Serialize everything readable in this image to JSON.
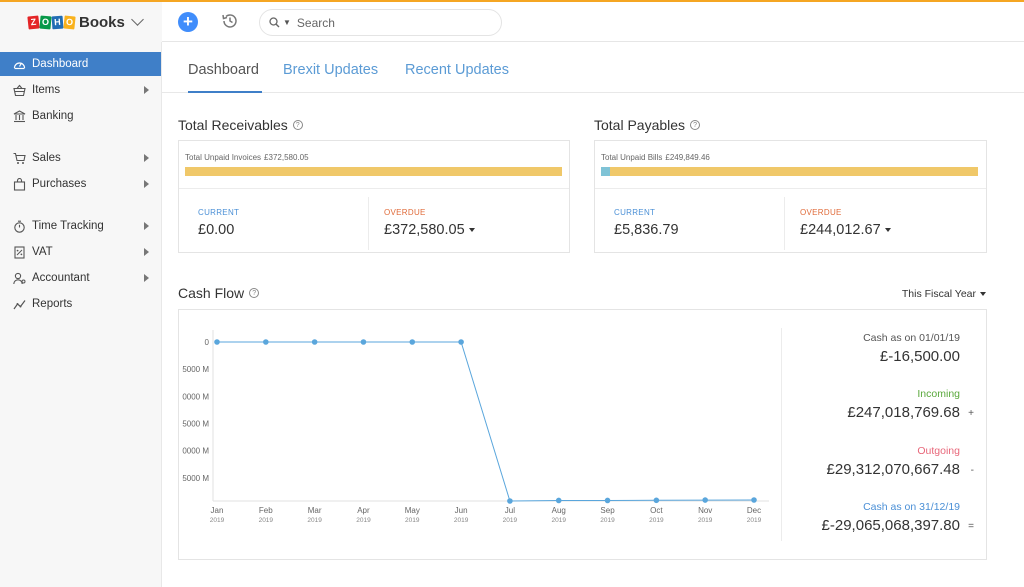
{
  "header": {
    "brand": "Books",
    "logo_letters": [
      "Z",
      "O",
      "H",
      "O"
    ],
    "search_placeholder": "Search"
  },
  "sidebar": {
    "items": [
      {
        "label": "Dashboard",
        "icon": "dashboard-icon",
        "active": true,
        "has_arrow": false
      },
      {
        "label": "Items",
        "icon": "basket-icon",
        "active": false,
        "has_arrow": true
      },
      {
        "label": "Banking",
        "icon": "bank-icon",
        "active": false,
        "has_arrow": false
      },
      {
        "label": "Sales",
        "icon": "cart-icon",
        "active": false,
        "has_arrow": true
      },
      {
        "label": "Purchases",
        "icon": "bag-icon",
        "active": false,
        "has_arrow": true
      },
      {
        "label": "Time Tracking",
        "icon": "stopwatch-icon",
        "active": false,
        "has_arrow": true
      },
      {
        "label": "VAT",
        "icon": "vat-doc-icon",
        "active": false,
        "has_arrow": true
      },
      {
        "label": "Accountant",
        "icon": "accountant-icon",
        "active": false,
        "has_arrow": true
      },
      {
        "label": "Reports",
        "icon": "reports-icon",
        "active": false,
        "has_arrow": false
      }
    ]
  },
  "tabs": [
    {
      "label": "Dashboard",
      "active": true
    },
    {
      "label": "Brexit Updates",
      "active": false
    },
    {
      "label": "Recent Updates",
      "active": false
    }
  ],
  "receivables": {
    "title": "Total Receivables",
    "bar_label": "Total Unpaid Invoices",
    "bar_amount": "£372,580.05",
    "current_fraction": 0,
    "current_label": "CURRENT",
    "current_value": "£0.00",
    "overdue_label": "OVERDUE",
    "overdue_value": "£372,580.05"
  },
  "payables": {
    "title": "Total Payables",
    "bar_label": "Total Unpaid Bills",
    "bar_amount": "£249,849.46",
    "current_fraction": 0.023,
    "current_label": "CURRENT",
    "current_value": "£5,836.79",
    "overdue_label": "OVERDUE",
    "overdue_value": "£244,012.67"
  },
  "cashflow": {
    "title": "Cash Flow",
    "period": "This Fiscal Year",
    "summary": {
      "opening_label": "Cash as on 01/01/19",
      "opening_value": "£-16,500.00",
      "incoming_label": "Incoming",
      "incoming_value": "£247,018,769.68",
      "incoming_sign": "+",
      "outgoing_label": "Outgoing",
      "outgoing_value": "£29,312,070,667.48",
      "outgoing_sign": "-",
      "closing_label": "Cash as on 31/12/19",
      "closing_value": "£-29,065,068,397.80",
      "closing_sign": "="
    }
  },
  "colors": {
    "accent": "#3f7fc8",
    "link_blue": "#5b9bd5",
    "bar_overdue": "#f0c869",
    "bar_current": "#7fc3d6",
    "incoming": "#5aa83c",
    "outgoing": "#e8677a",
    "closing": "#4a8fd6",
    "series": "#5aa6dc"
  },
  "chart_data": {
    "type": "line",
    "categories": [
      "Jan 2019",
      "Feb 2019",
      "Mar 2019",
      "Apr 2019",
      "May 2019",
      "Jun 2019",
      "Jul 2019",
      "Aug 2019",
      "Sep 2019",
      "Oct 2019",
      "Nov 2019",
      "Dec 2019"
    ],
    "x_month_labels": [
      "Jan",
      "Feb",
      "Mar",
      "Apr",
      "May",
      "Jun",
      "Jul",
      "Aug",
      "Sep",
      "Oct",
      "Nov",
      "Dec"
    ],
    "x_year_labels": [
      "2019",
      "2019",
      "2019",
      "2019",
      "2019",
      "2019",
      "2019",
      "2019",
      "2019",
      "2019",
      "2019",
      "2019"
    ],
    "y_tick_labels": [
      "0",
      "5000 M",
      "0000 M",
      "5000 M",
      "0000 M",
      "5000 M"
    ],
    "y_ticks": [
      0,
      -5000,
      -10000,
      -15000,
      -20000,
      -25000
    ],
    "ylim": [
      -29065,
      0
    ],
    "values": [
      -0.0165,
      -0.0165,
      -0.0165,
      -0.0165,
      -0.0165,
      -0.0165,
      -29250,
      -29150,
      -29150,
      -29120,
      -29080,
      -29065
    ],
    "grid": false,
    "title": "",
    "xlabel": "",
    "ylabel": ""
  }
}
